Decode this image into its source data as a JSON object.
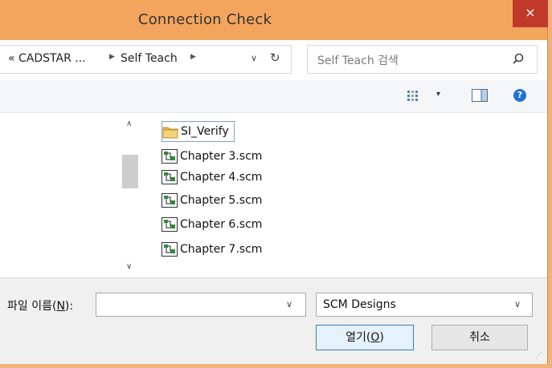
{
  "window": {
    "title": "Connection Check",
    "close_label": "×"
  },
  "address_bar": {
    "crumbs": [
      "« CADSTAR ...",
      "Self Teach"
    ],
    "separators": [
      "▶",
      "▶"
    ],
    "dropdown_glyph": "∨",
    "refresh_glyph": "↻"
  },
  "search": {
    "placeholder": "Self Teach 검색"
  },
  "toolbar": {
    "dropdown_glyph": "▾",
    "help_label": "?"
  },
  "scrollbar": {
    "up_glyph": "∧",
    "down_glyph": "∨"
  },
  "files": [
    {
      "name": "SI_Verify",
      "type": "folder",
      "selected": true
    },
    {
      "name": "Chapter 3.scm",
      "type": "scm"
    },
    {
      "name": "Chapter 4.scm",
      "type": "scm"
    },
    {
      "name": "Chapter 5.scm",
      "type": "scm"
    },
    {
      "name": "Chapter 6.scm",
      "type": "scm"
    },
    {
      "name": "Chapter 7.scm",
      "type": "scm"
    }
  ],
  "file_name": {
    "label_prefix": "파일 이름(",
    "label_key": "N",
    "label_suffix": "):",
    "value": ""
  },
  "file_type": {
    "selected": "SCM Designs"
  },
  "buttons": {
    "open_prefix": "열기(",
    "open_key": "O",
    "open_suffix": ")",
    "cancel": "취소"
  },
  "colors": {
    "title_bar": "#f3a55e",
    "close_button": "#c0392b",
    "selection_border": "#7da2ce",
    "help_icon": "#1e73d0"
  }
}
